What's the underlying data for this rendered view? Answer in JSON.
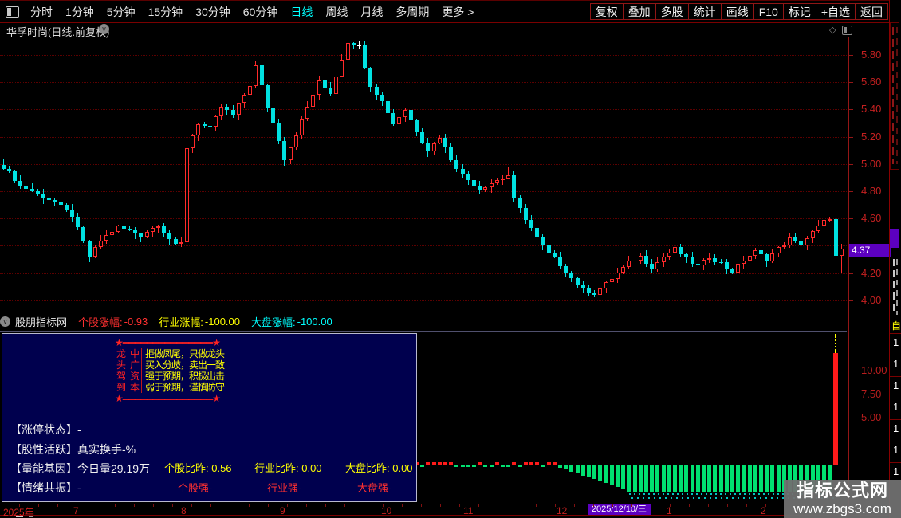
{
  "app": {
    "title": "华孚时尚(日线.前复权)",
    "toolbar_left": [
      "分时",
      "1分钟",
      "5分钟",
      "15分钟",
      "30分钟",
      "60分钟",
      "日线",
      "周线",
      "月线",
      "多周期",
      "更多 >"
    ],
    "toolbar_active_index": 6,
    "toolbar_right": [
      "复权",
      "叠加",
      "多股",
      "统计",
      "画线",
      "F10",
      "标记",
      "+自选",
      "返回"
    ]
  },
  "price_axis": {
    "labels": [
      "5.80",
      "5.60",
      "5.40",
      "5.20",
      "5.00",
      "4.80",
      "4.60",
      "4.20",
      "4.00"
    ],
    "values": [
      5.8,
      5.6,
      5.4,
      5.2,
      5.0,
      4.8,
      4.6,
      4.2,
      4.0
    ],
    "current_price": "4.37"
  },
  "indicator_header": {
    "name": "股朋指标网",
    "stock_label": "个股涨幅:",
    "stock_value": "-0.93",
    "industry_label": "行业涨幅:",
    "industry_value": "-100.00",
    "market_label": "大盘涨幅:",
    "market_value": "-100.00"
  },
  "panel": {
    "banner": {
      "star": "★",
      "fill": "═══════════════",
      "left_col": "龙头驾到",
      "right_col": "中广资本",
      "lines": [
        "拒做凤尾，只做龙头",
        "买入分歧，卖出一致",
        "强于预期，积极出击",
        "弱于预期，谨慎防守"
      ]
    },
    "status": [
      {
        "label": "【涨停状态】",
        "value": "-"
      },
      {
        "label": "【股性活跃】",
        "value": "真实换手-%"
      },
      {
        "label": "【量能基因】",
        "value": "今日量29.19万"
      },
      {
        "label": "【情绪共振】",
        "value": "-"
      }
    ],
    "ratios": [
      {
        "label": "个股比昨:",
        "value": "0.56"
      },
      {
        "label": "行业比昨:",
        "value": "0.00"
      },
      {
        "label": "大盘比昨:",
        "value": "0.00"
      }
    ],
    "strengths": [
      "个股强-",
      "行业强-",
      "大盘强-"
    ]
  },
  "date_axis": {
    "year": "2025年",
    "months": [
      {
        "label": "7",
        "x": 92
      },
      {
        "label": "8",
        "x": 227
      },
      {
        "label": "9",
        "x": 351
      },
      {
        "label": "10",
        "x": 478
      },
      {
        "label": "11",
        "x": 581
      },
      {
        "label": "12",
        "x": 698
      },
      {
        "label": "1",
        "x": 836
      },
      {
        "label": "2",
        "x": 954
      }
    ],
    "highlight_date": "2025/12/10/三"
  },
  "watermark": {
    "line1": "指标公式网",
    "line2": "www.zbgs3.com"
  },
  "sidebar": {
    "visible_char": "自",
    "digits": [
      "1",
      "1",
      "1",
      "1",
      "1",
      "1",
      "1"
    ]
  },
  "colors": {
    "up": "#ff2a2a",
    "down": "#00e2e2",
    "flat": "#ffffff",
    "grid": "#5c0000",
    "axis_text": "#c42020",
    "tag_bg": "#5c00c0",
    "panel_bg": "#00004e",
    "green_bar": "#00e070",
    "speckle": "#00c2c2",
    "red_bar": "#ff1a1a",
    "yellow": "#ffff00",
    "cyan": "#00ffff",
    "red": "#ff3030"
  },
  "chart_data": {
    "type": "candlestick+bar",
    "main": {
      "title": "华孚时尚 daily, 前复权, Jul 2025 - Feb 2026",
      "candle_count": 147,
      "ylim": [
        3.95,
        5.97
      ],
      "grid_step": 0.2,
      "last_close": 4.37,
      "price_path": [
        [
          0,
          4.98
        ],
        [
          3,
          4.84
        ],
        [
          6,
          4.78
        ],
        [
          9,
          4.72
        ],
        [
          12,
          4.62
        ],
        [
          15,
          4.32
        ],
        [
          17,
          4.44
        ],
        [
          20,
          4.54
        ],
        [
          24,
          4.48
        ],
        [
          27,
          4.56
        ],
        [
          30,
          4.4
        ],
        [
          31,
          4.42
        ],
        [
          32,
          5.12
        ],
        [
          34,
          5.3
        ],
        [
          36,
          5.26
        ],
        [
          38,
          5.42
        ],
        [
          40,
          5.36
        ],
        [
          43,
          5.58
        ],
        [
          44,
          5.72
        ],
        [
          46,
          5.42
        ],
        [
          48,
          5.18
        ],
        [
          49,
          5.04
        ],
        [
          51,
          5.22
        ],
        [
          53,
          5.42
        ],
        [
          55,
          5.6
        ],
        [
          57,
          5.52
        ],
        [
          60,
          5.9
        ],
        [
          62,
          5.86
        ],
        [
          64,
          5.58
        ],
        [
          66,
          5.46
        ],
        [
          68,
          5.3
        ],
        [
          70,
          5.4
        ],
        [
          72,
          5.24
        ],
        [
          74,
          5.1
        ],
        [
          76,
          5.2
        ],
        [
          78,
          5.04
        ],
        [
          80,
          4.92
        ],
        [
          83,
          4.82
        ],
        [
          86,
          4.88
        ],
        [
          88,
          4.92
        ],
        [
          89,
          4.74
        ],
        [
          91,
          4.6
        ],
        [
          93,
          4.46
        ],
        [
          95,
          4.34
        ],
        [
          97,
          4.26
        ],
        [
          99,
          4.16
        ],
        [
          101,
          4.08
        ],
        [
          103,
          4.05
        ],
        [
          105,
          4.12
        ],
        [
          107,
          4.2
        ],
        [
          109,
          4.28
        ],
        [
          111,
          4.32
        ],
        [
          113,
          4.24
        ],
        [
          115,
          4.32
        ],
        [
          117,
          4.38
        ],
        [
          119,
          4.3
        ],
        [
          121,
          4.25
        ],
        [
          123,
          4.32
        ],
        [
          125,
          4.27
        ],
        [
          127,
          4.21
        ],
        [
          129,
          4.3
        ],
        [
          131,
          4.36
        ],
        [
          133,
          4.3
        ],
        [
          135,
          4.38
        ],
        [
          137,
          4.45
        ],
        [
          139,
          4.41
        ],
        [
          141,
          4.5
        ],
        [
          143,
          4.58
        ],
        [
          144,
          4.61
        ],
        [
          145,
          4.32
        ],
        [
          146,
          4.37
        ]
      ],
      "wick_high_overrides": {
        "44": 5.76,
        "60": 5.97,
        "88": 4.98
      },
      "wick_low_overrides": {
        "15": 4.28,
        "103": 4.02,
        "146": 4.2
      }
    },
    "indicator": {
      "axis_labels": [
        "10.00",
        "7.50",
        "5.00"
      ],
      "axis_values": [
        10.0,
        7.5,
        5.0
      ],
      "gridlines": [
        10.0,
        5.0
      ],
      "zero_marks_days": [
        72,
        96
      ],
      "ramp_days": [
        97,
        108
      ],
      "green_block_days": [
        109,
        144
      ],
      "red_bar_day": 145,
      "red_bar_value": 11.9,
      "red_bar_clipped": true
    }
  }
}
